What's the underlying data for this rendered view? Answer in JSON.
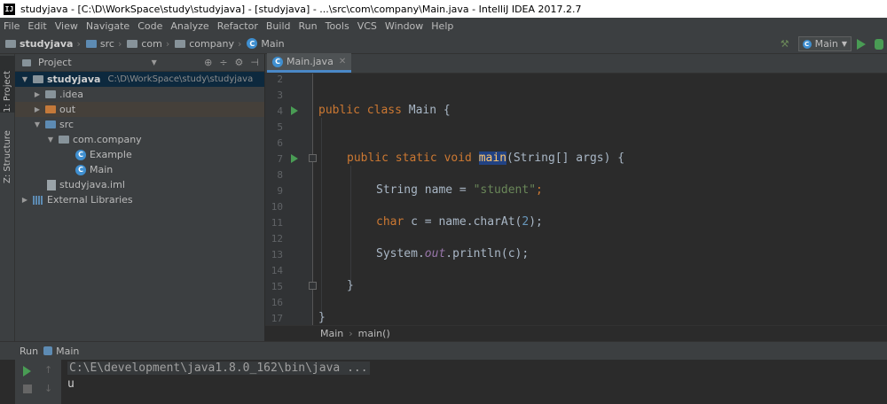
{
  "window": {
    "title": "studyjava - [C:\\D\\WorkSpace\\study\\studyjava] - [studyjava] - ...\\src\\com\\company\\Main.java - IntelliJ IDEA 2017.2.7",
    "logo_text": "IJ"
  },
  "menu": [
    "File",
    "Edit",
    "View",
    "Navigate",
    "Code",
    "Analyze",
    "Refactor",
    "Build",
    "Run",
    "Tools",
    "VCS",
    "Window",
    "Help"
  ],
  "nav": {
    "crumbs": [
      "studyjava",
      "src",
      "com",
      "company",
      "Main"
    ],
    "run_config": "Main"
  },
  "side_tabs": {
    "project": "1: Project",
    "structure": "Z: Structure"
  },
  "project_panel": {
    "header": "Project",
    "tree": {
      "root_name": "studyjava",
      "root_path": "C:\\D\\WorkSpace\\study\\studyjava",
      "idea": ".idea",
      "out": "out",
      "src": "src",
      "package": "com.company",
      "class1": "Example",
      "class2": "Main",
      "iml": "studyjava.iml",
      "libs": "External Libraries"
    }
  },
  "editor": {
    "tab": "Main.java",
    "line_numbers": [
      "2",
      "3",
      "4",
      "5",
      "6",
      "7",
      "8",
      "9",
      "10",
      "11",
      "12",
      "13",
      "14",
      "15",
      "16",
      "17"
    ],
    "code": {
      "l4_kw": "public class",
      "l4_rest": " Main {",
      "l7_kw": "public static void",
      "l7_method": "main",
      "l7_rest": "(String[] args) {",
      "l9_type": "String name = ",
      "l9_str": "\"student\"",
      "l9_end": ";",
      "l11_kw": "char",
      "l11_mid": " c = name.charAt(",
      "l11_num": "2",
      "l11_end": ");",
      "l13_a": "System.",
      "l13_field": "out",
      "l13_b": ".println(c);",
      "l15": "}",
      "l17": "}"
    },
    "breadcrumb": [
      "Main",
      "main()"
    ]
  },
  "run_panel": {
    "label": "Run",
    "tab": "Main",
    "command": "C:\\E\\development\\java1.8.0_162\\bin\\java ...",
    "output": "u"
  },
  "colors": {
    "keyword": "#cc7832",
    "string": "#6a8759",
    "number": "#6897bb",
    "field": "#9876aa",
    "run_green": "#499c54"
  }
}
